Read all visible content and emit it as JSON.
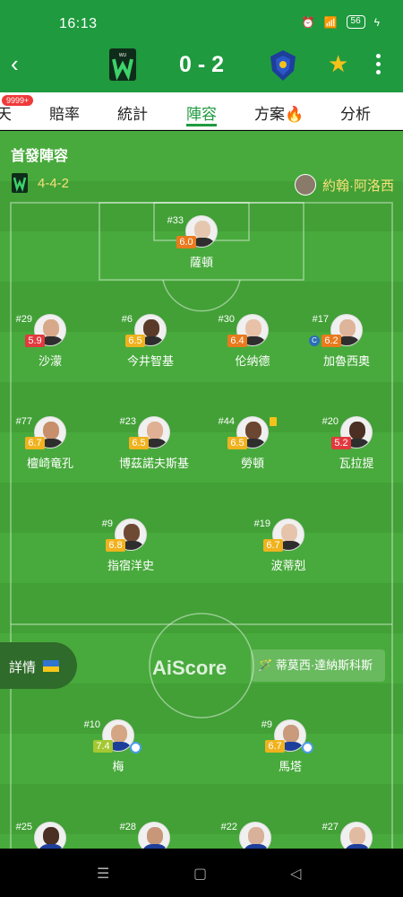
{
  "status_bar": {
    "time": "16:13",
    "battery": "56"
  },
  "match": {
    "score": "0 - 2"
  },
  "tabs": [
    {
      "label": "天"
    },
    {
      "label": "賠率"
    },
    {
      "label": "統計"
    },
    {
      "label": "陣容"
    },
    {
      "label": "方案🔥"
    },
    {
      "label": "分析"
    }
  ],
  "tab_badge": "9999+",
  "lineup": {
    "title": "首發陣容",
    "formation": "4-4-2",
    "coach": "約翰·阿洛西"
  },
  "home_players": [
    {
      "num": "#33",
      "rating": "6.0",
      "rating_color": "#e97a1d",
      "name": "薩頓"
    },
    {
      "num": "#29",
      "rating": "5.9",
      "rating_color": "#e2393e",
      "name": "沙濛"
    },
    {
      "num": "#6",
      "rating": "6.5",
      "rating_color": "#f0b21e",
      "name": "今井智基"
    },
    {
      "num": "#30",
      "rating": "6.4",
      "rating_color": "#e97a1d",
      "name": "伦纳德"
    },
    {
      "num": "#17",
      "rating": "6.2",
      "rating_color": "#e97a1d",
      "name": "加魯西奧",
      "captain": "C"
    },
    {
      "num": "#77",
      "rating": "6.7",
      "rating_color": "#f0b21e",
      "name": "檀崎竜孔"
    },
    {
      "num": "#23",
      "rating": "6.5",
      "rating_color": "#f0b21e",
      "name": "博茲諾夫斯基"
    },
    {
      "num": "#44",
      "rating": "6.5",
      "rating_color": "#f0b21e",
      "name": "勞頓"
    },
    {
      "num": "#20",
      "rating": "5.2",
      "rating_color": "#e2393e",
      "name": "瓦拉提"
    },
    {
      "num": "#9",
      "rating": "6.8",
      "rating_color": "#f0b21e",
      "name": "指宿洋史"
    },
    {
      "num": "#19",
      "rating": "6.7",
      "rating_color": "#f0b21e",
      "name": "波蒂剋"
    }
  ],
  "away_players": [
    {
      "num": "#10",
      "rating": "7.4",
      "rating_color": "#a5c832",
      "name": "梅"
    },
    {
      "num": "#9",
      "rating": "6.7",
      "rating_color": "#f0b21e",
      "name": "馬塔"
    },
    {
      "num": "#25"
    },
    {
      "num": "#28"
    },
    {
      "num": "#22"
    },
    {
      "num": "#27"
    }
  ],
  "details_button": "詳情",
  "watermark": "AiScore",
  "referee": "蒂莫西·達納斯科斯",
  "colors": {
    "brand_green": "#1f9a3f",
    "pitch": "#45a63a",
    "accent_yellow": "#f6e27a"
  }
}
